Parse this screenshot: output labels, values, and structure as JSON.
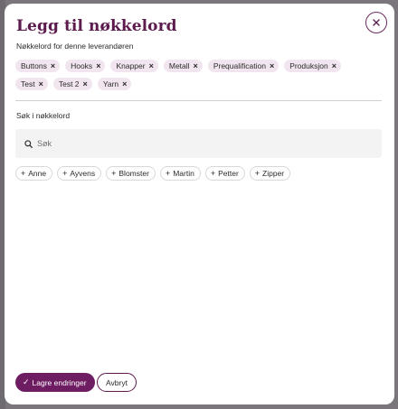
{
  "modal": {
    "title": "Legg til nøkkelord",
    "close_icon": "close-icon",
    "subtitle": "Nøkkelord for denne leverandøren",
    "selected_keywords": [
      "Buttons",
      "Hooks",
      "Knapper",
      "Metall",
      "Prequalification",
      "Produksjon",
      "Test",
      "Test 2",
      "Yarn"
    ],
    "search": {
      "label": "Søk i nøkkelord",
      "placeholder": "Søk",
      "value": "",
      "icon": "search-icon"
    },
    "suggested_keywords": [
      "Anne",
      "Ayvens",
      "Blomster",
      "Martin",
      "Petter",
      "Zipper"
    ],
    "actions": {
      "save_label": "Lagre endringer",
      "cancel_label": "Avbryt"
    }
  },
  "colors": {
    "accent": "#6e1d63",
    "title": "#5c1a4d",
    "chip_bg": "#f1e6ef",
    "backdrop": "#7a767c"
  }
}
